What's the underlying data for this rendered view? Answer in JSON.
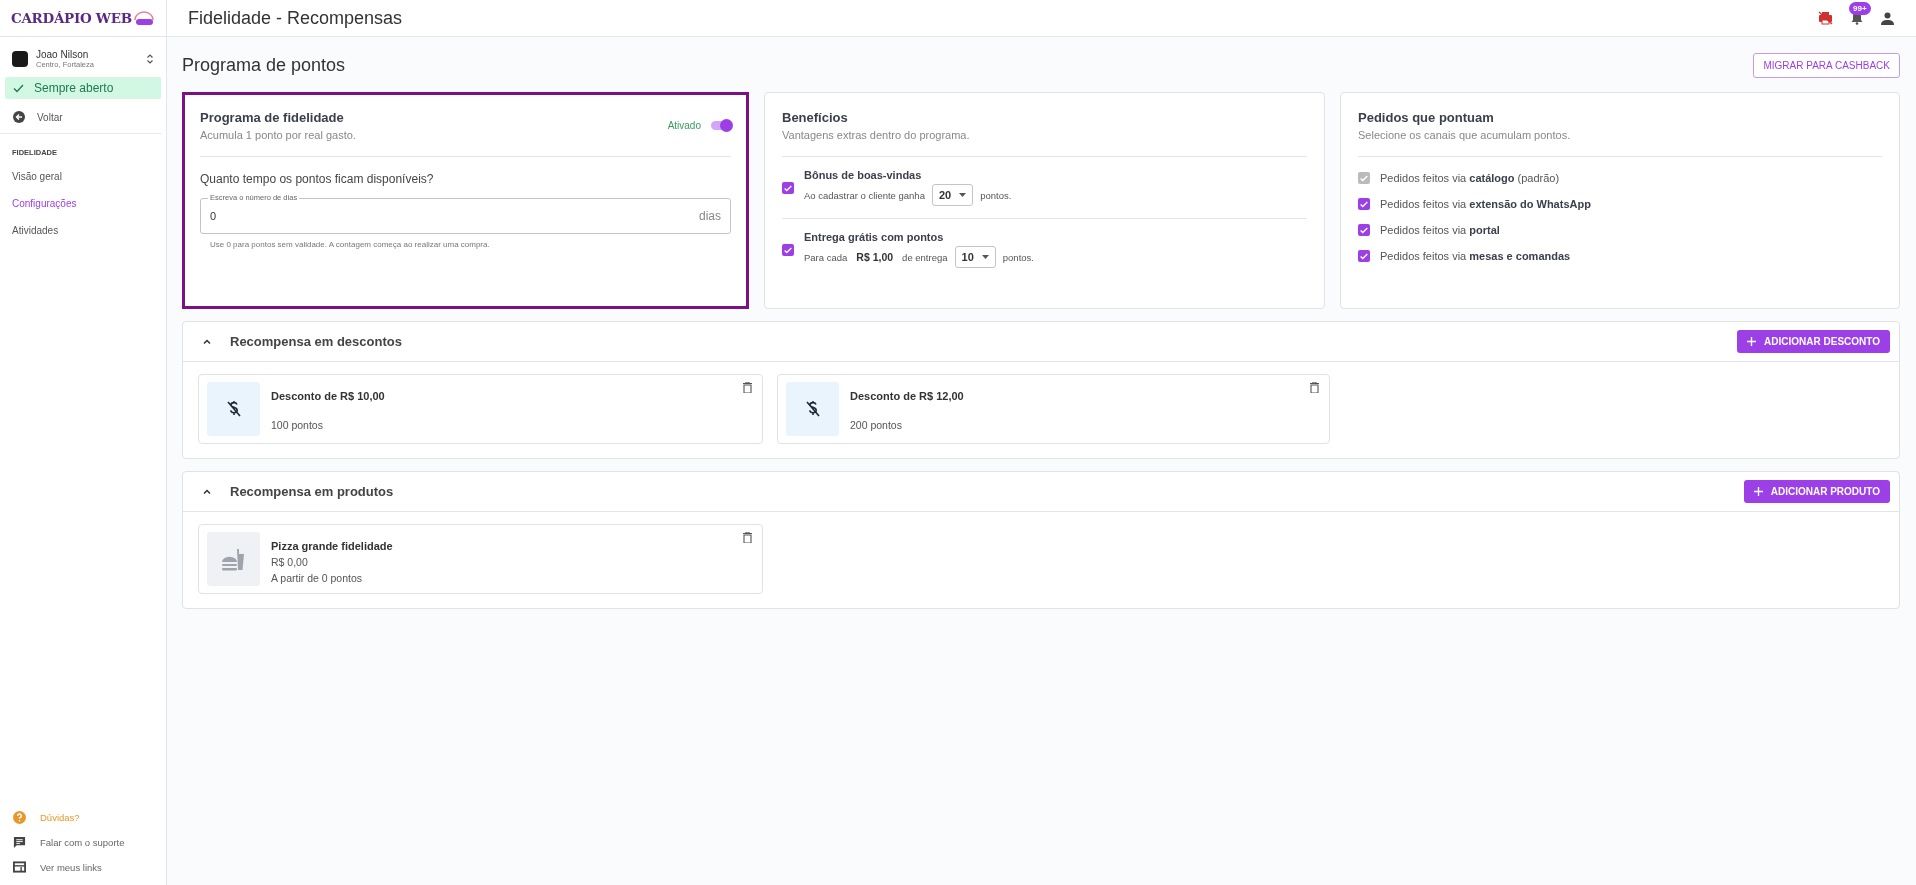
{
  "sidebar": {
    "logo": "CARDÁPIO WEB",
    "store": {
      "name": "Joao Nilson",
      "location": "Centro, Fortaleza"
    },
    "status": "Sempre aberto",
    "back": "Voltar",
    "section": "FIDELIDADE",
    "items": [
      {
        "label": "Visão geral",
        "selected": false
      },
      {
        "label": "Configurações",
        "selected": true
      },
      {
        "label": "Atividades",
        "selected": false
      }
    ],
    "footer": [
      {
        "label": "Dúvidas?",
        "kind": "help"
      },
      {
        "label": "Falar com o suporte",
        "kind": "chat"
      },
      {
        "label": "Ver meus links",
        "kind": "links"
      }
    ]
  },
  "header": {
    "title": "Fidelidade - Recompensas",
    "notification_badge": "99+"
  },
  "page": {
    "title": "Programa de pontos",
    "action": "MIGRAR PARA CASHBACK"
  },
  "loyalty_card": {
    "title": "Programa de fidelidade",
    "subtitle": "Acumula 1 ponto por real gasto.",
    "status_label": "Ativado",
    "on": true,
    "question": "Quanto tempo os pontos ficam disponíveis?",
    "field": {
      "label": "Escreva o número de dias",
      "value": "0",
      "suffix": "dias"
    },
    "hint": "Use 0 para pontos sem validade. A contagem começa ao realizar uma compra."
  },
  "benefits": {
    "title": "Benefícios",
    "subtitle": "Vantagens extras dentro do programa.",
    "items": [
      {
        "title": "Bônus de boas-vindas",
        "checked": true,
        "line": [
          {
            "kind": "text",
            "text": "Ao cadastrar o cliente ganha"
          },
          {
            "kind": "select",
            "value": "20"
          },
          {
            "kind": "text",
            "text": "pontos."
          }
        ]
      },
      {
        "title": "Entrega grátis com pontos",
        "checked": true,
        "line": [
          {
            "kind": "text",
            "text": "Para cada"
          },
          {
            "kind": "amount",
            "text": "R$ 1,00"
          },
          {
            "kind": "text",
            "text": "de entrega"
          },
          {
            "kind": "select",
            "value": "10"
          },
          {
            "kind": "text",
            "text": "pontos."
          }
        ]
      }
    ]
  },
  "channels": {
    "title": "Pedidos que pontuam",
    "subtitle": "Selecione os canais que acumulam pontos.",
    "items": [
      {
        "label": "Pedidos feitos via **catálogo** (padrão)",
        "checked": true,
        "disabled": true
      },
      {
        "label": "Pedidos feitos via **extensão do WhatsApp**",
        "checked": true,
        "disabled": false
      },
      {
        "label": "Pedidos feitos via **portal**",
        "checked": true,
        "disabled": false
      },
      {
        "label": "Pedidos feitos via **mesas e comandas**",
        "checked": true,
        "disabled": false
      }
    ]
  },
  "sections": [
    {
      "kind": "discount",
      "title": "Recompensa em descontos",
      "expanded": true,
      "button": "ADICIONAR DESCONTO",
      "rewards": [
        {
          "title": "Desconto de R$ 10,00",
          "lines": [
            "100 pontos"
          ]
        },
        {
          "title": "Desconto de R$ 12,00",
          "lines": [
            "200 pontos"
          ]
        }
      ]
    },
    {
      "kind": "product",
      "title": "Recompensa em produtos",
      "expanded": true,
      "button": "ADICIONAR PRODUTO",
      "rewards": [
        {
          "title": "Pizza grande fidelidade",
          "lines": [
            "R$ 0,00",
            "A partir de 0 pontos"
          ]
        }
      ]
    }
  ]
}
